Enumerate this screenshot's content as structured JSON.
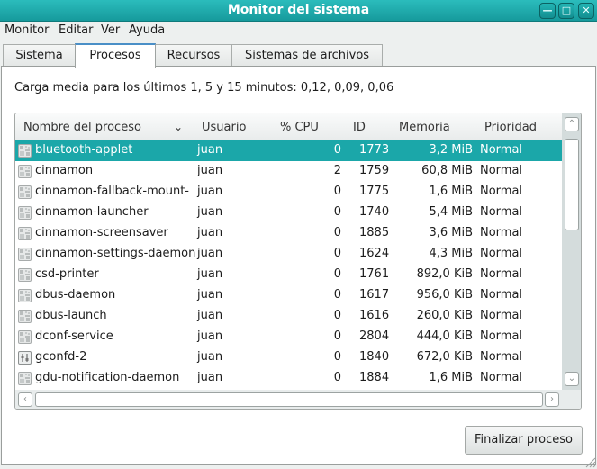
{
  "window": {
    "title": "Monitor del sistema",
    "controls": [
      "minimize",
      "maximize",
      "close"
    ]
  },
  "menubar": [
    "Monitor",
    "Editar",
    "Ver",
    "Ayuda"
  ],
  "tabs": [
    {
      "label": "Sistema",
      "active": false
    },
    {
      "label": "Procesos",
      "active": true
    },
    {
      "label": "Recursos",
      "active": false
    },
    {
      "label": "Sistemas de archivos",
      "active": false
    }
  ],
  "load_average": "Carga media para los últimos 1, 5 y 15 minutos: 0,12, 0,09, 0,06",
  "table": {
    "columns": [
      "Nombre del proceso",
      "Usuario",
      "% CPU",
      "ID",
      "Memoria",
      "Prioridad"
    ],
    "sort_indicator": "chevron-down",
    "selected_index": 0,
    "rows": [
      {
        "icon": "generic-process-icon",
        "name": "bluetooth-applet",
        "user": "juan",
        "cpu": "0",
        "id": "1773",
        "memory": "3,2 MiB",
        "priority": "Normal"
      },
      {
        "icon": "generic-process-icon",
        "name": "cinnamon",
        "user": "juan",
        "cpu": "2",
        "id": "1759",
        "memory": "60,8 MiB",
        "priority": "Normal"
      },
      {
        "icon": "generic-process-icon",
        "name": "cinnamon-fallback-mount-",
        "user": "juan",
        "cpu": "0",
        "id": "1775",
        "memory": "1,6 MiB",
        "priority": "Normal"
      },
      {
        "icon": "generic-process-icon",
        "name": "cinnamon-launcher",
        "user": "juan",
        "cpu": "0",
        "id": "1740",
        "memory": "5,4 MiB",
        "priority": "Normal"
      },
      {
        "icon": "generic-process-icon",
        "name": "cinnamon-screensaver",
        "user": "juan",
        "cpu": "0",
        "id": "1885",
        "memory": "3,6 MiB",
        "priority": "Normal"
      },
      {
        "icon": "generic-process-icon",
        "name": "cinnamon-settings-daemon",
        "user": "juan",
        "cpu": "0",
        "id": "1624",
        "memory": "4,3 MiB",
        "priority": "Normal"
      },
      {
        "icon": "generic-process-icon",
        "name": "csd-printer",
        "user": "juan",
        "cpu": "0",
        "id": "1761",
        "memory": "892,0 KiB",
        "priority": "Normal"
      },
      {
        "icon": "generic-process-icon",
        "name": "dbus-daemon",
        "user": "juan",
        "cpu": "0",
        "id": "1617",
        "memory": "956,0 KiB",
        "priority": "Normal"
      },
      {
        "icon": "generic-process-icon",
        "name": "dbus-launch",
        "user": "juan",
        "cpu": "0",
        "id": "1616",
        "memory": "260,0 KiB",
        "priority": "Normal"
      },
      {
        "icon": "generic-process-icon",
        "name": "dconf-service",
        "user": "juan",
        "cpu": "0",
        "id": "2804",
        "memory": "444,0 KiB",
        "priority": "Normal"
      },
      {
        "icon": "config-editor-icon",
        "name": "gconfd-2",
        "user": "juan",
        "cpu": "0",
        "id": "1840",
        "memory": "672,0 KiB",
        "priority": "Normal"
      },
      {
        "icon": "generic-process-icon",
        "name": "gdu-notification-daemon",
        "user": "juan",
        "cpu": "0",
        "id": "1884",
        "memory": "1,6 MiB",
        "priority": "Normal"
      }
    ]
  },
  "buttons": {
    "end_process": "Finalizar proceso"
  },
  "colors": {
    "titlebar": "#1ba7a9",
    "selection": "#1ba7a9",
    "active_tab_accent": "#4a8fc7"
  }
}
